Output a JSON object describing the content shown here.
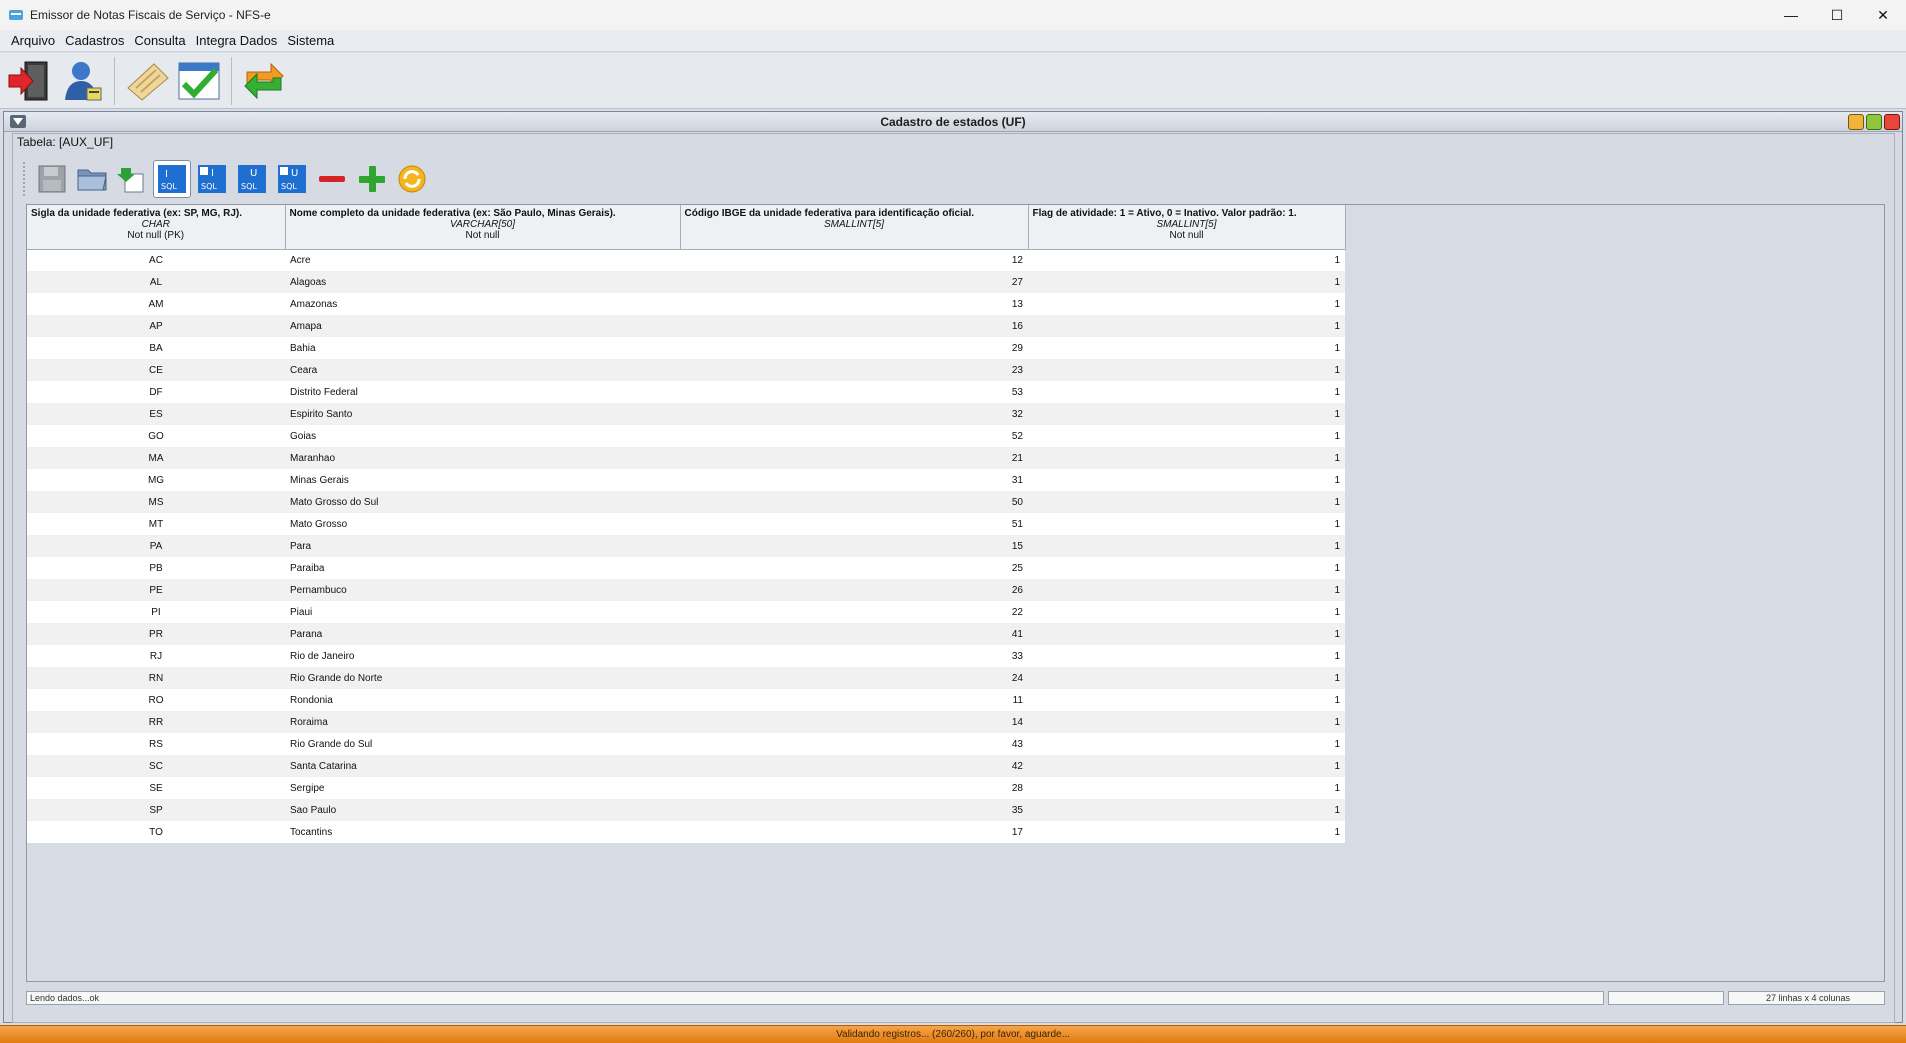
{
  "window": {
    "title": "Emissor de Notas Fiscais de Serviço - NFS-e",
    "controls": {
      "minimize": "—",
      "maximize": "☐",
      "close": "✕"
    }
  },
  "menu": [
    "Arquivo",
    "Cadastros",
    "Consulta",
    "Integra Dados",
    "Sistema"
  ],
  "internal_frame": {
    "title": "Cadastro de estados (UF)",
    "table_caption": "Tabela: [AUX_UF]"
  },
  "columns": [
    {
      "label": "Sigla da unidade federativa (ex: SP, MG, RJ).",
      "type": "CHAR",
      "constraint": "Not null (PK)"
    },
    {
      "label": "Nome completo da unidade federativa (ex: São Paulo, Minas Gerais).",
      "type": "VARCHAR[50]",
      "constraint": "Not null"
    },
    {
      "label": "Código IBGE da unidade federativa para identificação oficial.",
      "type": "SMALLINT[5]",
      "constraint": ""
    },
    {
      "label": "Flag de atividade: 1 = Ativo, 0 = Inativo. Valor padrão: 1.",
      "type": "SMALLINT[5]",
      "constraint": "Not null"
    }
  ],
  "rows": [
    [
      "AC",
      "Acre",
      "12",
      "1"
    ],
    [
      "AL",
      "Alagoas",
      "27",
      "1"
    ],
    [
      "AM",
      "Amazonas",
      "13",
      "1"
    ],
    [
      "AP",
      "Amapa",
      "16",
      "1"
    ],
    [
      "BA",
      "Bahia",
      "29",
      "1"
    ],
    [
      "CE",
      "Ceara",
      "23",
      "1"
    ],
    [
      "DF",
      "Distrito Federal",
      "53",
      "1"
    ],
    [
      "ES",
      "Espirito Santo",
      "32",
      "1"
    ],
    [
      "GO",
      "Goias",
      "52",
      "1"
    ],
    [
      "MA",
      "Maranhao",
      "21",
      "1"
    ],
    [
      "MG",
      "Minas Gerais",
      "31",
      "1"
    ],
    [
      "MS",
      "Mato Grosso do Sul",
      "50",
      "1"
    ],
    [
      "MT",
      "Mato Grosso",
      "51",
      "1"
    ],
    [
      "PA",
      "Para",
      "15",
      "1"
    ],
    [
      "PB",
      "Paraiba",
      "25",
      "1"
    ],
    [
      "PE",
      "Pernambuco",
      "26",
      "1"
    ],
    [
      "PI",
      "Piaui",
      "22",
      "1"
    ],
    [
      "PR",
      "Parana",
      "41",
      "1"
    ],
    [
      "RJ",
      "Rio de Janeiro",
      "33",
      "1"
    ],
    [
      "RN",
      "Rio Grande do Norte",
      "24",
      "1"
    ],
    [
      "RO",
      "Rondonia",
      "11",
      "1"
    ],
    [
      "RR",
      "Roraima",
      "14",
      "1"
    ],
    [
      "RS",
      "Rio Grande do Sul",
      "43",
      "1"
    ],
    [
      "SC",
      "Santa Catarina",
      "42",
      "1"
    ],
    [
      "SE",
      "Sergipe",
      "28",
      "1"
    ],
    [
      "SP",
      "Sao Paulo",
      "35",
      "1"
    ],
    [
      "TO",
      "Tocantins",
      "17",
      "1"
    ]
  ],
  "status": {
    "message": "Lendo dados...ok",
    "middle": "",
    "dimensions": "27 linhas x 4 colunas"
  },
  "progress_text": "Validando registros... (260/260), por favor, aguarde...",
  "colors": {
    "accent_orange": "#e88a22",
    "sql_blue": "#1f6fd1",
    "remove_red": "#d42525",
    "add_green": "#2fa52f"
  }
}
